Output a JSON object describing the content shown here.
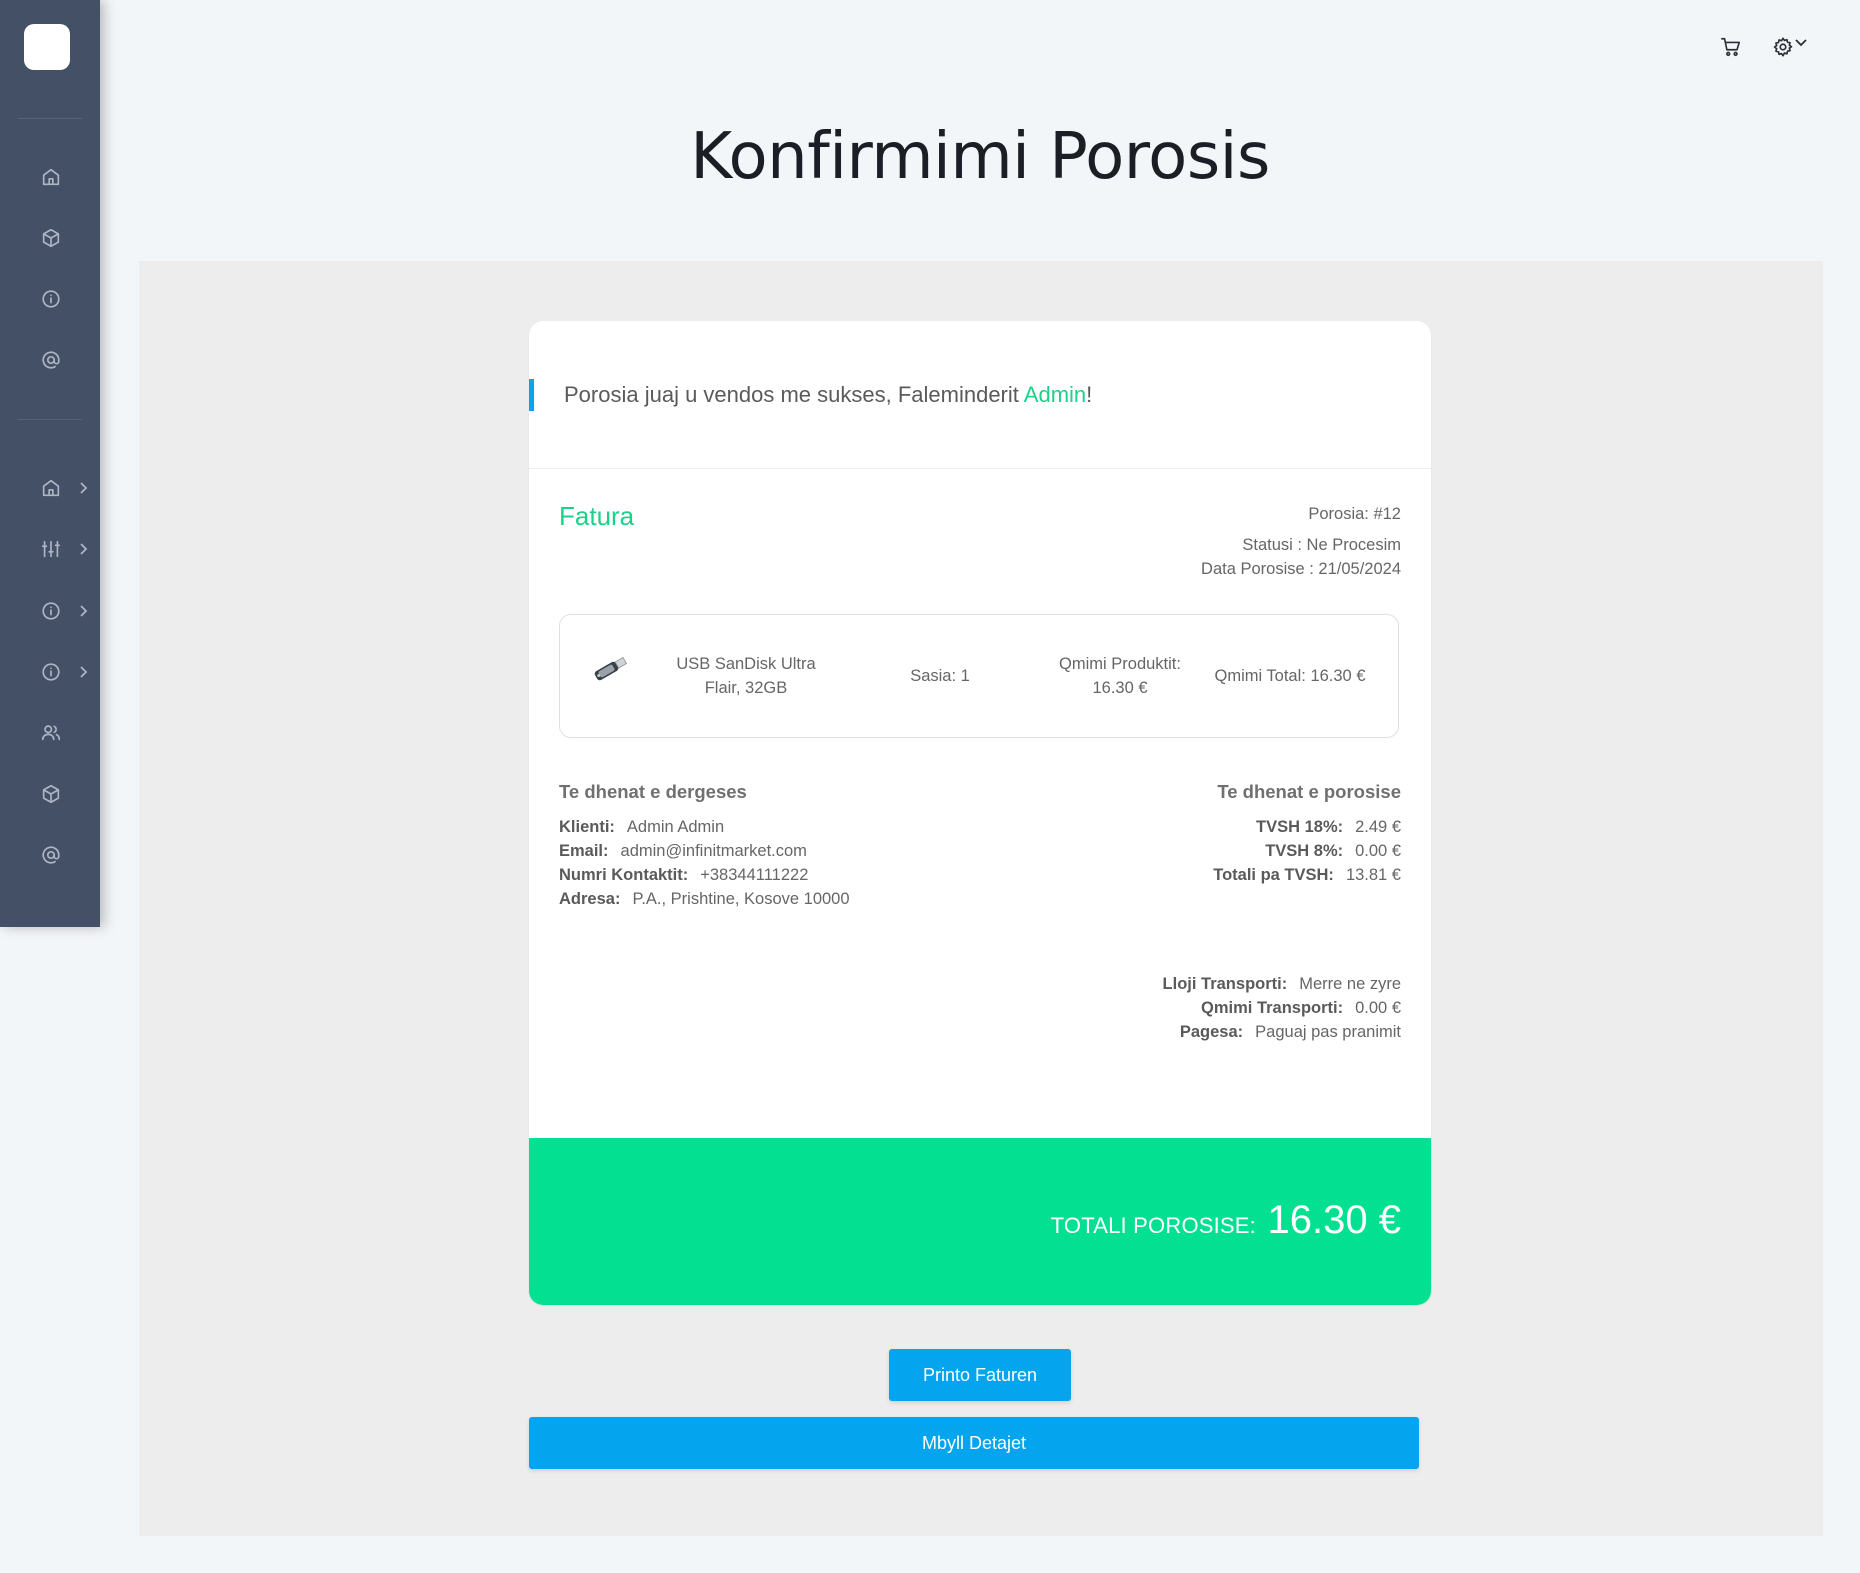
{
  "page": {
    "title": "Konfirmimi Porosis"
  },
  "sidebar": {
    "items": [
      {
        "icon": "home-icon",
        "has_chevron": false
      },
      {
        "icon": "box-icon",
        "has_chevron": false
      },
      {
        "icon": "info-icon",
        "has_chevron": false
      },
      {
        "icon": "at-icon",
        "has_chevron": false
      },
      {
        "icon": "home-icon",
        "has_chevron": true
      },
      {
        "icon": "sliders-icon",
        "has_chevron": true
      },
      {
        "icon": "info-icon",
        "has_chevron": true
      },
      {
        "icon": "info-icon",
        "has_chevron": true
      },
      {
        "icon": "users-icon",
        "has_chevron": false
      },
      {
        "icon": "box-icon",
        "has_chevron": false
      },
      {
        "icon": "at-icon",
        "has_chevron": false
      }
    ]
  },
  "topbar": {
    "icons": [
      "cart-icon",
      "gear-icon",
      "chevron-down-icon"
    ]
  },
  "confirmation": {
    "message_prefix": "Porosia juaj u vendos me sukses, Faleminderit ",
    "user_name": "Admin",
    "message_suffix": "!"
  },
  "invoice": {
    "title": "Fatura",
    "order_number": "Porosia: #12",
    "status": "Statusi : Ne Procesim",
    "order_date": "Data Porosise : 21/05/2024"
  },
  "product": {
    "name_line1": "USB SanDisk Ultra",
    "name_line2": "Flair, 32GB",
    "quantity": "Sasia: 1",
    "price_label": "Qmimi Produktit:",
    "price_value": "16.30 €",
    "total": "Qmimi Total: 16.30 €"
  },
  "shipping": {
    "title": "Te dhenat e dergeses",
    "client_label": "Klienti:",
    "client_value": "Admin Admin",
    "email_label": "Email:",
    "email_value": "admin@infinitmarket.com",
    "phone_label": "Numri Kontaktit:",
    "phone_value": "+38344111222",
    "address_label": "Adresa:",
    "address_value": "P.A., Prishtine, Kosove 10000"
  },
  "order_details": {
    "title": "Te dhenat e porosise",
    "vat18_label": "TVSH 18%:",
    "vat18_value": "2.49 €",
    "vat8_label": "TVSH 8%:",
    "vat8_value": "0.00 €",
    "subtotal_label": "Totali pa TVSH:",
    "subtotal_value": "13.81 €",
    "transport_type_label": "Lloji Transporti:",
    "transport_type_value": "Merre ne zyre",
    "transport_price_label": "Qmimi Transporti:",
    "transport_price_value": "0.00 €",
    "payment_label": "Pagesa:",
    "payment_value": "Paguaj pas pranimit"
  },
  "total": {
    "label": "TOTALI POROSISE:",
    "value": "16.30 €"
  },
  "buttons": {
    "print": "Printo Faturen",
    "close": "Mbyll Detajet"
  },
  "colors": {
    "sidebar_bg": "#435066",
    "accent_green": "#03e092",
    "accent_blue": "#04a4ee",
    "page_bg": "#f3f6f9",
    "panel_bg": "#ededed"
  }
}
